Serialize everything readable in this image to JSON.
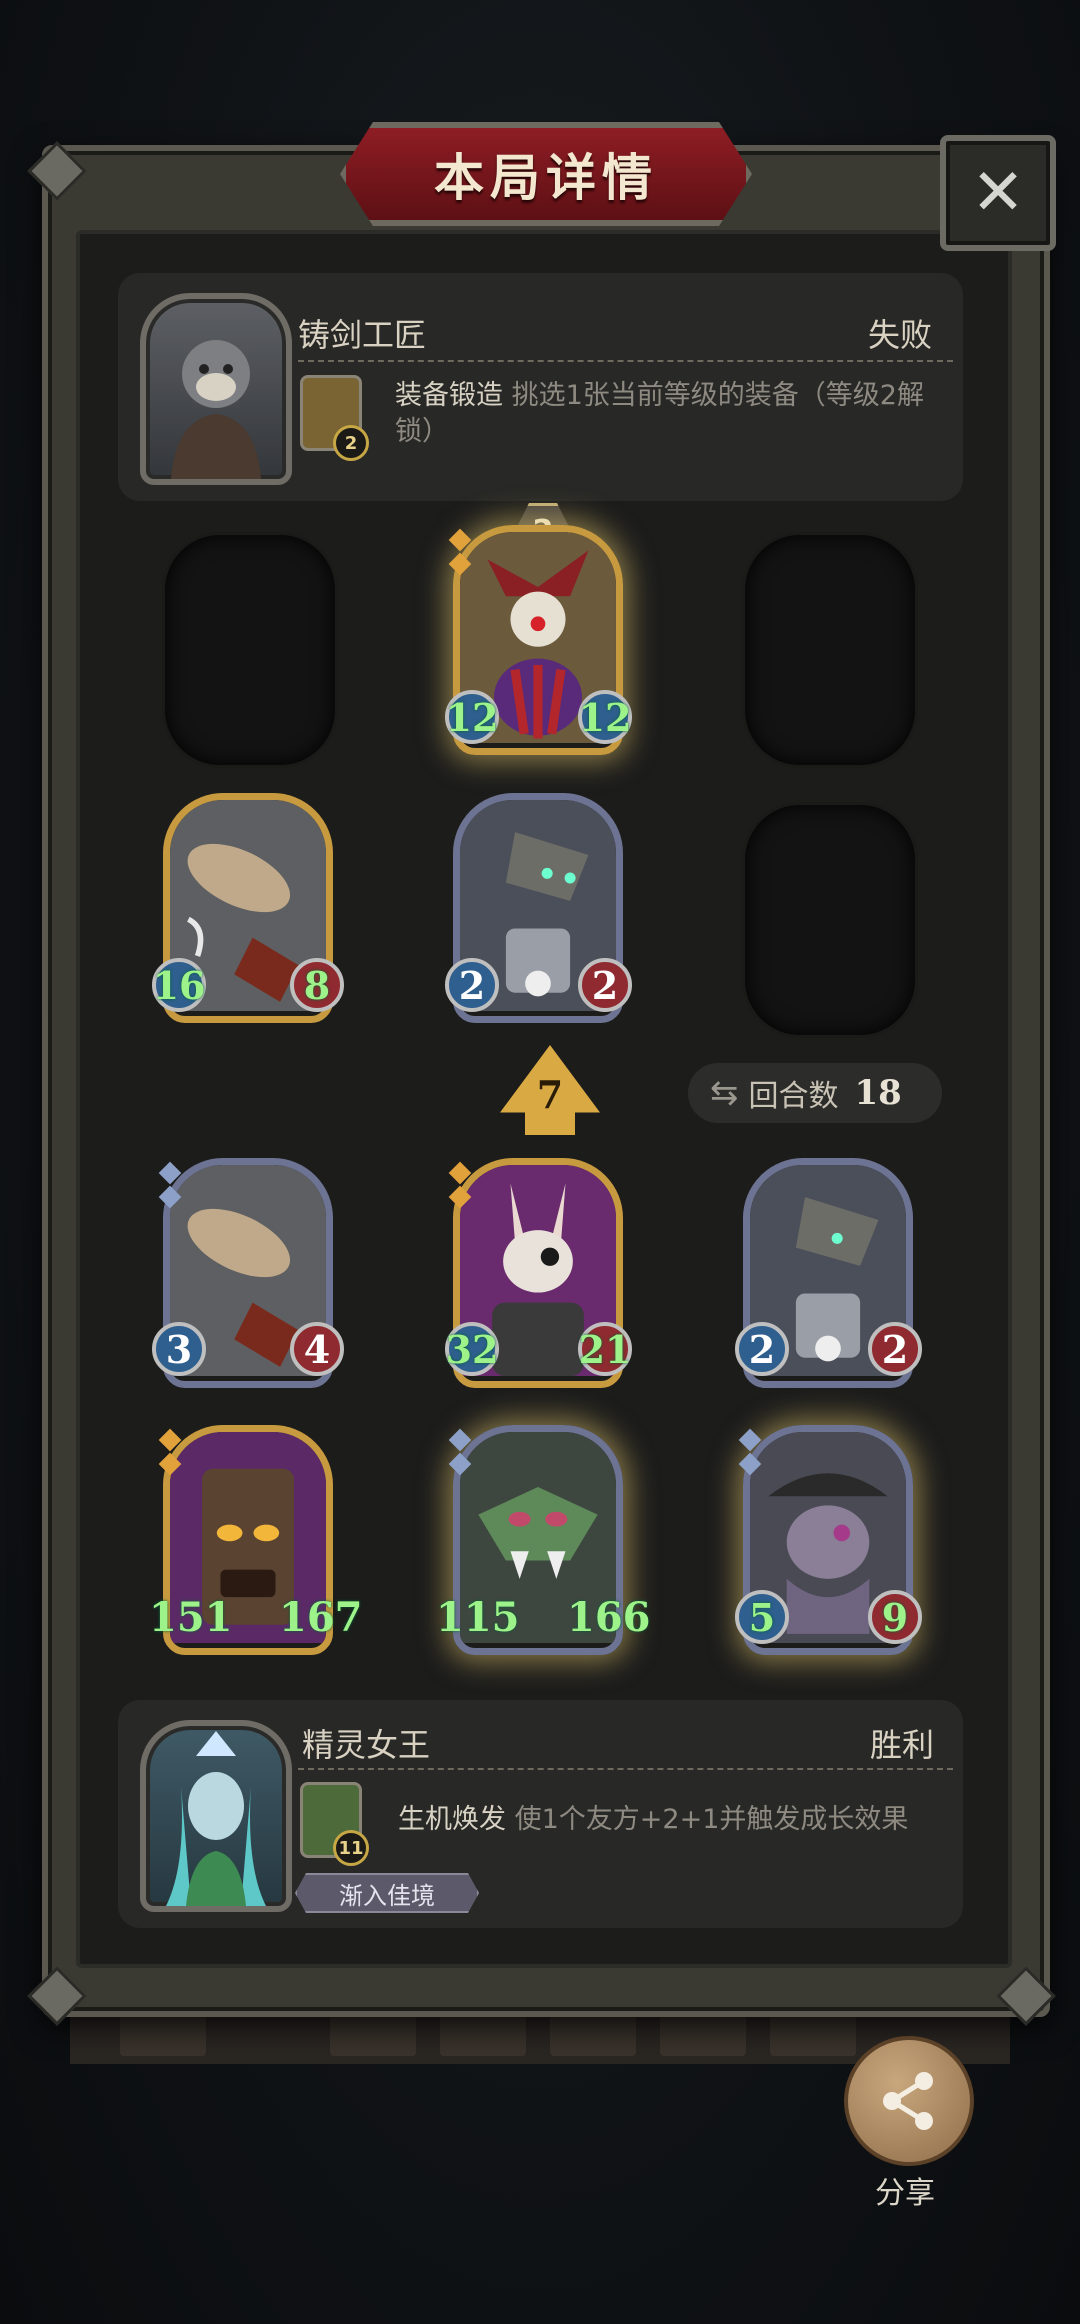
{
  "header": {
    "title": "本局详情"
  },
  "top_hero": {
    "name": "铸剑工匠",
    "result": "失败",
    "skill": {
      "level": "2",
      "name": "装备锻造",
      "description": "挑选1张当前等级的装备（等级2解锁）"
    }
  },
  "level_badge": "2",
  "opponent_cards": [
    {
      "attack": "12",
      "health": "12"
    },
    {
      "attack": "16",
      "health": "8"
    },
    {
      "attack": "2",
      "health": "2"
    }
  ],
  "turn_arrow": "7",
  "rounds": {
    "label": "回合数",
    "value": "18"
  },
  "player_cards": [
    {
      "attack": "3",
      "health": "4"
    },
    {
      "attack": "32",
      "health": "21"
    },
    {
      "attack": "2",
      "health": "2"
    },
    {
      "attack": "151",
      "health": "167"
    },
    {
      "attack": "115",
      "health": "166"
    },
    {
      "attack": "5",
      "health": "9"
    }
  ],
  "bottom_hero": {
    "name": "精灵女王",
    "result": "胜利",
    "skill": {
      "level": "11",
      "name": "生机焕发",
      "description": "使1个友方+2+1并触发成长效果"
    },
    "tag": "渐入佳境"
  },
  "share": {
    "label": "分享"
  },
  "icons": {
    "close": "close-icon",
    "share": "share-icon",
    "rounds": "swap-icon"
  },
  "colors": {
    "title_banner": "#8e1d24",
    "gold_frame": "#c79a3f",
    "silver_frame": "#6d7392",
    "attack": "#2e5f8e",
    "health": "#8e2a30"
  }
}
